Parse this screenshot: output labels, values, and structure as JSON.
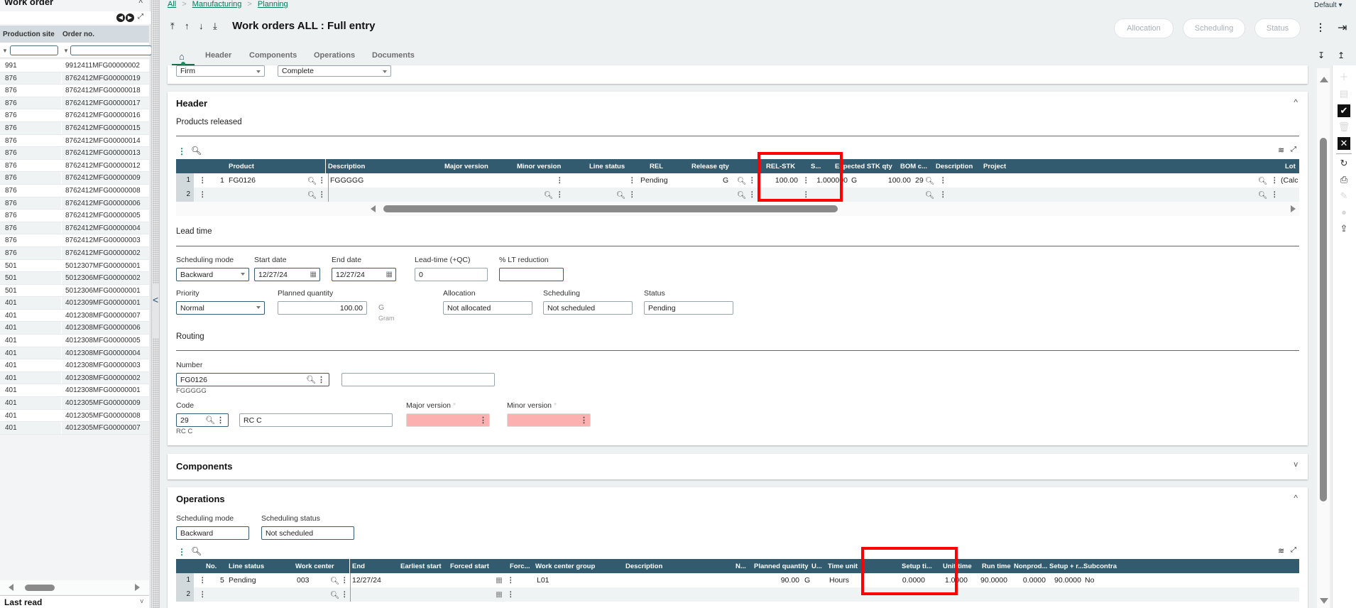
{
  "left_panel": {
    "title": "Work order",
    "columns": [
      "Production site",
      "Order no."
    ],
    "rows": [
      {
        "site": "991",
        "order": "9912411MFG00000002"
      },
      {
        "site": "876",
        "order": "8762412MFG00000019"
      },
      {
        "site": "876",
        "order": "8762412MFG00000018"
      },
      {
        "site": "876",
        "order": "8762412MFG00000017"
      },
      {
        "site": "876",
        "order": "8762412MFG00000016"
      },
      {
        "site": "876",
        "order": "8762412MFG00000015"
      },
      {
        "site": "876",
        "order": "8762412MFG00000014"
      },
      {
        "site": "876",
        "order": "8762412MFG00000013"
      },
      {
        "site": "876",
        "order": "8762412MFG00000012"
      },
      {
        "site": "876",
        "order": "8762412MFG00000009"
      },
      {
        "site": "876",
        "order": "8762412MFG00000008"
      },
      {
        "site": "876",
        "order": "8762412MFG00000006"
      },
      {
        "site": "876",
        "order": "8762412MFG00000005"
      },
      {
        "site": "876",
        "order": "8762412MFG00000004"
      },
      {
        "site": "876",
        "order": "8762412MFG00000003"
      },
      {
        "site": "876",
        "order": "8762412MFG00000002"
      },
      {
        "site": "501",
        "order": "5012307MFG00000001"
      },
      {
        "site": "501",
        "order": "5012306MFG00000002"
      },
      {
        "site": "501",
        "order": "5012306MFG00000001"
      },
      {
        "site": "401",
        "order": "4012309MFG00000001"
      },
      {
        "site": "401",
        "order": "4012308MFG00000007"
      },
      {
        "site": "401",
        "order": "4012308MFG00000006"
      },
      {
        "site": "401",
        "order": "4012308MFG00000005"
      },
      {
        "site": "401",
        "order": "4012308MFG00000004"
      },
      {
        "site": "401",
        "order": "4012308MFG00000003"
      },
      {
        "site": "401",
        "order": "4012308MFG00000002"
      },
      {
        "site": "401",
        "order": "4012308MFG00000001"
      },
      {
        "site": "401",
        "order": "4012305MFG00000009"
      },
      {
        "site": "401",
        "order": "4012305MFG00000008"
      },
      {
        "site": "401",
        "order": "4012305MFG00000007"
      }
    ],
    "last_read": "Last read"
  },
  "breadcrumb": [
    "All",
    "Manufacturing",
    "Planning"
  ],
  "page_title": "Work orders ALL : Full entry",
  "actions": {
    "allocation": "Allocation",
    "scheduling": "Scheduling",
    "status": "Status"
  },
  "profile": "Default",
  "tabs": [
    "Header",
    "Components",
    "Operations",
    "Documents"
  ],
  "top_fields": {
    "type": "Firm",
    "completion": "Complete"
  },
  "header": {
    "title": "Header",
    "products_released": {
      "title": "Products released",
      "columns": [
        "Product",
        "Description",
        "Major version",
        "Minor version",
        "Line status",
        "REL",
        "Release qty",
        "REL-STK",
        "S...",
        "Expected STK qty",
        "BOM c...",
        "Description",
        "Project",
        "Lot"
      ],
      "rows": [
        {
          "num": "1",
          "line": "1",
          "product": "FG0126",
          "description": "FGGGGG",
          "line_status": "Pending",
          "rel": "G",
          "release_qty": "100.00",
          "rel_stk": "1.000000",
          "s": "G",
          "expected_stk_qty": "100.00",
          "bom_code": "29",
          "lot": "(Calc"
        },
        {
          "num": "2",
          "line": "",
          "product": "",
          "description": "",
          "line_status": "",
          "rel": "",
          "release_qty": "",
          "rel_stk": "",
          "s": "",
          "expected_stk_qty": "",
          "bom_code": "",
          "lot": ""
        }
      ]
    },
    "lead_time": {
      "title": "Lead time",
      "scheduling_mode_label": "Scheduling mode",
      "scheduling_mode": "Backward",
      "start_date_label": "Start date",
      "start_date": "12/27/24",
      "end_date_label": "End date",
      "end_date": "12/27/24",
      "lead_time_label": "Lead-time (+QC)",
      "lead_time": "0",
      "lt_reduction_label": "% LT reduction",
      "lt_reduction": "",
      "priority_label": "Priority",
      "priority": "Normal",
      "planned_qty_label": "Planned quantity",
      "planned_qty": "100.00",
      "unit": "G",
      "unit_desc": "Gram",
      "allocation_label": "Allocation",
      "allocation": "Not allocated",
      "scheduling_label": "Scheduling",
      "scheduling": "Not scheduled",
      "status_label": "Status",
      "status": "Pending"
    },
    "routing": {
      "title": "Routing",
      "number_label": "Number",
      "number": "FG0126",
      "number_desc": "FGGGGG",
      "number_extra": "",
      "code_label": "Code",
      "code": "29",
      "code_name": "RC C",
      "code_desc": "RC C",
      "major_version_label": "Major version",
      "minor_version_label": "Minor version",
      "major_version": "",
      "minor_version": ""
    }
  },
  "components": {
    "title": "Components"
  },
  "operations": {
    "title": "Operations",
    "scheduling_mode_label": "Scheduling mode",
    "scheduling_mode": "Backward",
    "scheduling_status_label": "Scheduling status",
    "scheduling_status": "Not scheduled",
    "columns": [
      "No.",
      "Line status",
      "Work center",
      "End",
      "Earliest start",
      "Forced start",
      "Forc...",
      "Work center group",
      "Description",
      "N...",
      "Planned quantity",
      "U...",
      "Time unit",
      "Setup ti...",
      "Unit time",
      "Run time",
      "Nonprod...",
      "Setup + r...",
      "Subcontra"
    ],
    "rows": [
      {
        "num": "1",
        "no": "5",
        "line_status": "Pending",
        "work_center": "003",
        "end": "12/27/24",
        "wc_group": "L01",
        "planned_qty": "90.00",
        "unit": "G",
        "time_unit": "Hours",
        "setup_time": "0.0000",
        "unit_time": "1.0000",
        "run_time": "90.0000",
        "nonprod": "0.0000",
        "setup_run": "90.0000",
        "subcontract": "No"
      },
      {
        "num": "2"
      }
    ]
  },
  "colors": {
    "grid_header": "#335b6f",
    "highlight": "#ff0000",
    "link": "#007a5a",
    "error_field": "#fcb0b0"
  }
}
